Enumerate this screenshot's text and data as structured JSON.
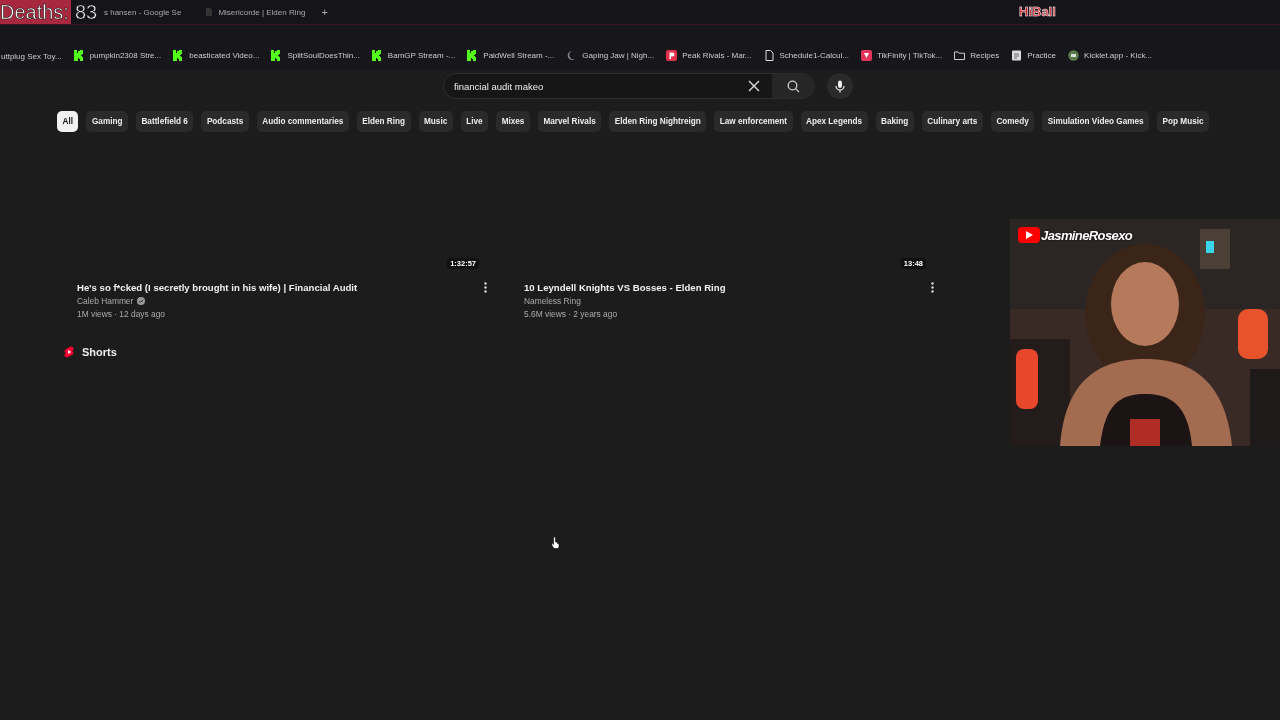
{
  "overlay": {
    "counter_label": "Deaths:",
    "counter_value": "83",
    "tag": "HiBall"
  },
  "tabs": [
    {
      "label": "s hansen - Google Se",
      "kind": "google"
    },
    {
      "label": "Misericorde | Elden Ring",
      "kind": "blank"
    }
  ],
  "new_tab": "+",
  "bookmarks": [
    {
      "label": "uttplug Sex Toy...",
      "kind": "none"
    },
    {
      "label": "pumpkin2308 Stre...",
      "kind": "kick"
    },
    {
      "label": "beasticated Video...",
      "kind": "kick"
    },
    {
      "label": "SplitSoulDoesThin...",
      "kind": "kick"
    },
    {
      "label": "BamGP Stream -...",
      "kind": "kick"
    },
    {
      "label": "PaidWell Stream -...",
      "kind": "kick"
    },
    {
      "label": "Gaping Jaw | Nigh...",
      "kind": "moon"
    },
    {
      "label": "Peak Rivals - Mar...",
      "kind": "peak"
    },
    {
      "label": "Schedule1-Calcul...",
      "kind": "doc"
    },
    {
      "label": "TikFinity | TikTok...",
      "kind": "tikfinity"
    },
    {
      "label": "Recipes",
      "kind": "folder"
    },
    {
      "label": "Practice",
      "kind": "practice"
    },
    {
      "label": "Kicklet.app - Kick...",
      "kind": "kicklet"
    }
  ],
  "search": {
    "value": "financial audit makeo"
  },
  "chips": [
    {
      "label": "All",
      "selected": true
    },
    {
      "label": "Gaming",
      "selected": false
    },
    {
      "label": "Battlefield 6",
      "selected": false
    },
    {
      "label": "Podcasts",
      "selected": false
    },
    {
      "label": "Audio commentaries",
      "selected": false
    },
    {
      "label": "Elden Ring",
      "selected": false
    },
    {
      "label": "Music",
      "selected": false
    },
    {
      "label": "Live",
      "selected": false
    },
    {
      "label": "Mixes",
      "selected": false
    },
    {
      "label": "Marvel Rivals",
      "selected": false
    },
    {
      "label": "Elden Ring Nightreign",
      "selected": false
    },
    {
      "label": "Law enforcement",
      "selected": false
    },
    {
      "label": "Apex Legends",
      "selected": false
    },
    {
      "label": "Baking",
      "selected": false
    },
    {
      "label": "Culinary arts",
      "selected": false
    },
    {
      "label": "Comedy",
      "selected": false
    },
    {
      "label": "Simulation Video Games",
      "selected": false
    },
    {
      "label": "Pop Music",
      "selected": false
    }
  ],
  "videos": [
    {
      "duration": "1:32:57",
      "title": "He's so f*cked (I secretly brought in his wife) | Financial Audit",
      "channel": "Caleb Hammer",
      "verified": true,
      "meta": "1M views · 12 days ago"
    },
    {
      "duration": "13:48",
      "title": "10 Leyndell Knights VS Bosses - Elden Ring",
      "channel": "Nameless Ring",
      "verified": false,
      "meta": "5.6M views · 2 years ago"
    }
  ],
  "shorts": {
    "title": "Shorts"
  },
  "webcam": {
    "kind": "picture",
    "channel_name": "JasmineRosexo"
  }
}
